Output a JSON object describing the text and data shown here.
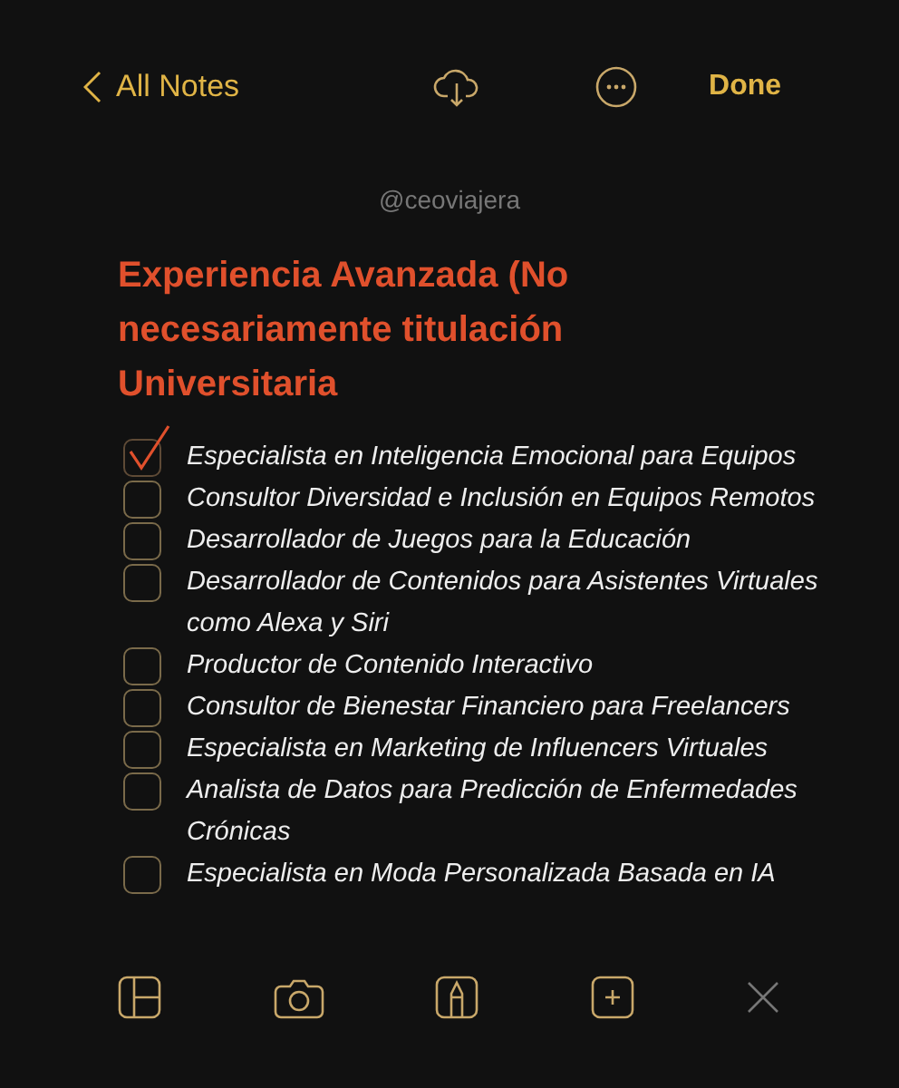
{
  "nav": {
    "back": "All Notes",
    "done": "Done"
  },
  "author": "@ceoviajera",
  "title": "Experiencia Avanzada (No necesariamente titulación Universitaria",
  "checklist": [
    {
      "text": "Especialista en Inteligencia Emocional para Equipos",
      "checked": true
    },
    {
      "text": "Consultor Diversidad e Inclusión en Equipos Remotos",
      "checked": false
    },
    {
      "text": "Desarrollador de Juegos para la Educación",
      "checked": false
    },
    {
      "text": "Desarrollador de Contenidos para Asistentes Virtuales como Alexa y Siri",
      "checked": false
    },
    {
      "text": "Productor de Contenido Interactivo",
      "checked": false
    },
    {
      "text": "Consultor de Bienestar Financiero para Freelancers",
      "checked": false
    },
    {
      "text": "Especialista en Marketing de Influencers Virtuales",
      "checked": false
    },
    {
      "text": "Analista de Datos para Predicción de Enfermedades Crónicas",
      "checked": false
    },
    {
      "text": "Especialista en Moda Personalizada Basada en IA",
      "checked": false
    }
  ]
}
